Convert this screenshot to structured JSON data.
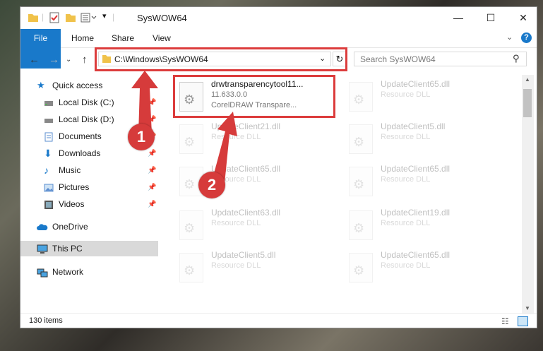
{
  "window": {
    "title": "SysWOW64"
  },
  "controls": {
    "minimize": "—",
    "maximize": "☐",
    "close": "✕"
  },
  "ribbon": {
    "tabs": [
      "File",
      "Home",
      "Share",
      "View"
    ],
    "help": "?"
  },
  "address": {
    "path": "C:\\Windows\\SysWOW64",
    "search_placeholder": "Search SysWOW64"
  },
  "nav": {
    "items": [
      {
        "label": "Quick access"
      },
      {
        "label": "Local Disk (C:)"
      },
      {
        "label": "Local Disk (D:)"
      },
      {
        "label": "Documents"
      },
      {
        "label": "Downloads"
      },
      {
        "label": "Music"
      },
      {
        "label": "Pictures"
      },
      {
        "label": "Videos"
      },
      {
        "label": "OneDrive"
      },
      {
        "label": "This PC"
      },
      {
        "label": "Network"
      }
    ]
  },
  "files": [
    {
      "name": "drwtransparencytool11...",
      "line2": "11.633.0.0",
      "line3": "CorelDRAW Transpare..."
    },
    {
      "name": "UpdateClient65.dll",
      "line2": "Resource DLL"
    },
    {
      "name": "UpdateClient21.dll",
      "line2": "Resource DLL"
    },
    {
      "name": "UpdateClient5.dll",
      "line2": "Resource DLL"
    },
    {
      "name": "UpdateClient65.dll",
      "line2": "Resource DLL"
    },
    {
      "name": "UpdateClient65.dll",
      "line2": "Resource DLL"
    },
    {
      "name": "UpdateClient63.dll",
      "line2": "Resource DLL"
    },
    {
      "name": "UpdateClient19.dll",
      "line2": "Resource DLL"
    },
    {
      "name": "UpdateClient5.dll",
      "line2": "Resource DLL"
    },
    {
      "name": "UpdateClient65.dll",
      "line2": "Resource DLL"
    }
  ],
  "status": {
    "count": "130 items"
  },
  "annotations": {
    "badge1": "1",
    "badge2": "2"
  },
  "colors": {
    "accent": "#1979ca",
    "highlight": "#dc3c3c"
  }
}
